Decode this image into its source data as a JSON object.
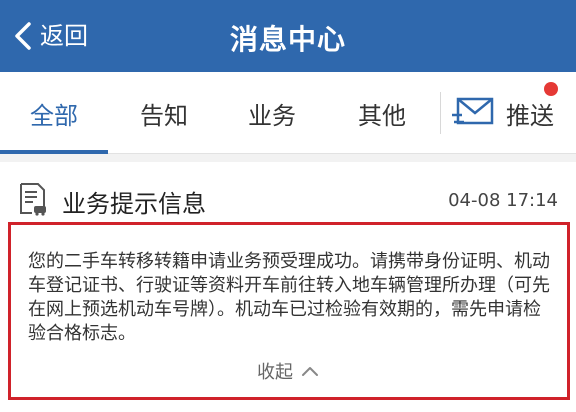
{
  "header": {
    "back_label": "返回",
    "title": "消息中心"
  },
  "tabs": [
    {
      "label": "全部",
      "active": true
    },
    {
      "label": "告知",
      "active": false
    },
    {
      "label": "业务",
      "active": false
    },
    {
      "label": "其他",
      "active": false
    }
  ],
  "push": {
    "label": "推送",
    "icon": "envelope-icon",
    "has_unread_dot": true
  },
  "message_card": {
    "icon": "document-car-icon",
    "title": "业务提示信息",
    "time": "04-08 17:14",
    "body": "您的二手车转移转籍申请业务预受理成功。请携带身份证明、机动车登记证书、行驶证等资料开车前往转入地车辆管理所办理（可先在网上预选机动车号牌）。机动车已过检验有效期的，需先申请检验合格标志。",
    "collapse_label": "收起"
  },
  "colors": {
    "primary": "#2f68ad",
    "highlight_border": "#d0222a",
    "unread_dot": "#e53935"
  }
}
